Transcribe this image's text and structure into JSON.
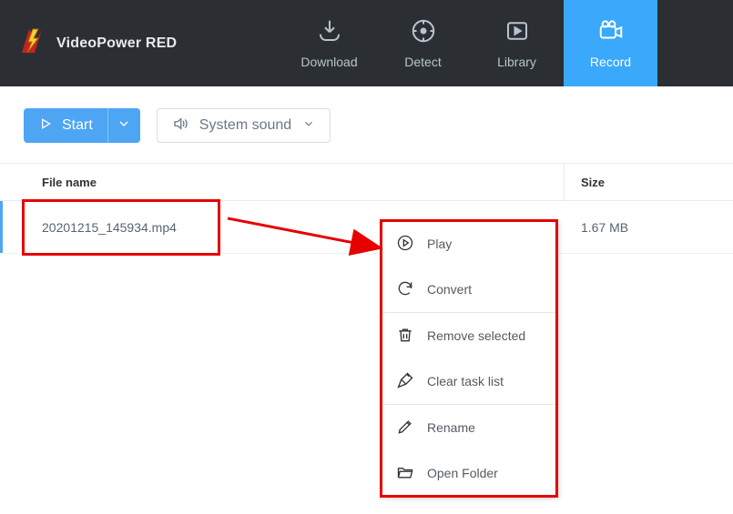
{
  "brand": {
    "title": "VideoPower RED"
  },
  "tabs": {
    "download": "Download",
    "detect": "Detect",
    "library": "Library",
    "record": "Record"
  },
  "toolbar": {
    "start_label": "Start",
    "sound_label": "System sound"
  },
  "table": {
    "col_name": "File name",
    "col_size": "Size",
    "rows": [
      {
        "name": "20201215_145934.mp4",
        "size": "1.67 MB"
      }
    ]
  },
  "ctxmenu": {
    "play": "Play",
    "convert": "Convert",
    "remove": "Remove selected",
    "clear": "Clear task list",
    "rename": "Rename",
    "open": "Open Folder"
  }
}
